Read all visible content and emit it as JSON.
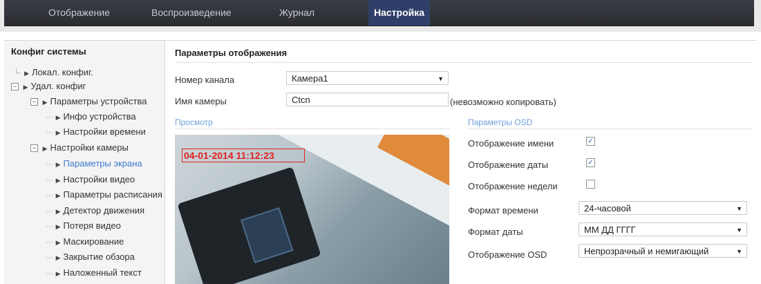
{
  "nav": {
    "tabs": [
      {
        "label": "Отображение"
      },
      {
        "label": "Воспроизведение"
      },
      {
        "label": "Журнал"
      },
      {
        "label": "Настройка"
      }
    ]
  },
  "sidebar": {
    "title": "Конфиг системы",
    "items": [
      {
        "label": "Локал. конфиг."
      },
      {
        "label": "Удал. конфиг"
      },
      {
        "label": "Параметры устройства"
      },
      {
        "label": "Инфо устройства"
      },
      {
        "label": "Настройки времени"
      },
      {
        "label": "Настройки камеры"
      },
      {
        "label": "Параметры экрана"
      },
      {
        "label": "Настройки видео"
      },
      {
        "label": "Параметры расписания"
      },
      {
        "label": "Детектор движения"
      },
      {
        "label": "Потеря видео"
      },
      {
        "label": "Маскирование"
      },
      {
        "label": "Закрытие обзора"
      },
      {
        "label": "Наложенный текст"
      }
    ]
  },
  "main": {
    "title": "Параметры отображения",
    "channel_label": "Номер канала",
    "channel_value": "Камера1",
    "camera_name_label": "Имя камеры",
    "camera_name_value": "Ctcn",
    "camera_name_note": "(невозможно копировать)",
    "preview_title": "Просмотр",
    "osd_overlay_text": "04-01-2014 11:12:23",
    "osd": {
      "title": "Параметры OSD",
      "show_name_label": "Отображение имени",
      "show_name_checked": true,
      "show_date_label": "Отображение даты",
      "show_date_checked": true,
      "show_week_label": "Отображение недели",
      "show_week_checked": false,
      "time_format_label": "Формат времени",
      "time_format_value": "24-часовой",
      "date_format_label": "Формат даты",
      "date_format_value": "ММ ДД ГГГГ",
      "osd_display_label": "Отображение OSD",
      "osd_display_value": "Непрозрачный и немигающий"
    }
  },
  "colors": {
    "nav_bg": "#2c2f35",
    "nav_active": "#2f3f6a",
    "link_blue": "#3d7ccf",
    "osd_red": "#e32020"
  }
}
